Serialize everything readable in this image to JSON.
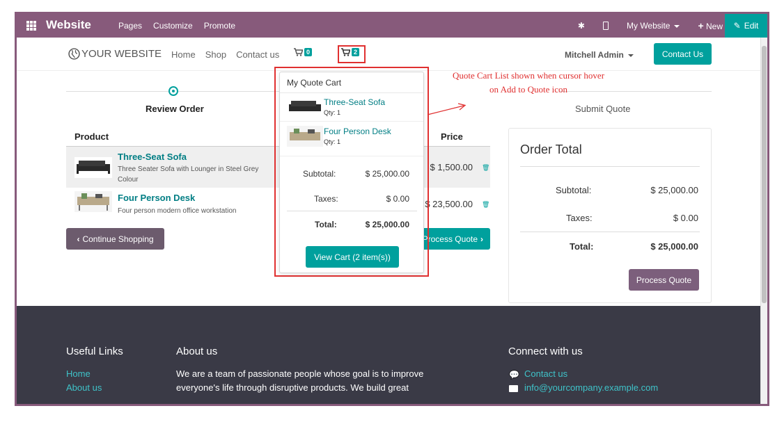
{
  "adminbar": {
    "brand": "Website",
    "menu": [
      "Pages",
      "Customize",
      "Promote"
    ],
    "my_website": "My Website",
    "new_label": "New",
    "edit_label": "Edit"
  },
  "header": {
    "logo": "YOUR WEBSITE",
    "nav": [
      "Home",
      "Shop",
      "Contact us"
    ],
    "cart_count": "0",
    "quote_cart_count": "2",
    "user": "Mitchell Admin",
    "contact_btn": "Contact Us"
  },
  "steps": {
    "review": "Review Order",
    "submit": "Submit Quote"
  },
  "table": {
    "headers": {
      "product": "Product",
      "price": "Price"
    },
    "rows": [
      {
        "name": "Three-Seat Sofa",
        "desc": "Three Seater Sofa with Lounger in Steel Grey Colour",
        "price": "$ 1,500.00"
      },
      {
        "name": "Four Person Desk",
        "desc": "Four person modern office workstation",
        "price": "$ 23,500.00"
      }
    ]
  },
  "buttons": {
    "continue": "Continue Shopping",
    "process_left": "Process Quote"
  },
  "order_total": {
    "title": "Order Total",
    "subtotal_label": "Subtotal:",
    "subtotal": "$ 25,000.00",
    "taxes_label": "Taxes:",
    "taxes": "$ 0.00",
    "total_label": "Total:",
    "total": "$ 25,000.00",
    "process": "Process Quote"
  },
  "popover": {
    "title": "My Quote Cart",
    "items": [
      {
        "name": "Three-Seat Sofa",
        "qty": "Qty: 1"
      },
      {
        "name": "Four Person Desk",
        "qty": "Qty: 1"
      }
    ],
    "subtotal_label": "Subtotal:",
    "subtotal": "$ 25,000.00",
    "taxes_label": "Taxes:",
    "taxes": "$ 0.00",
    "total_label": "Total:",
    "total": "$ 25,000.00",
    "view_cart": "View Cart (2 item(s))"
  },
  "annotation": "Quote Cart List shown when cursor hover on Add to Quote icon",
  "footer": {
    "useful_links": "Useful Links",
    "links": [
      "Home",
      "About us"
    ],
    "about_title": "About us",
    "about_text": "We are a team of passionate people whose goal is to improve everyone's life through disruptive products. We build great",
    "connect_title": "Connect with us",
    "contact_link": "Contact us",
    "email": "info@yourcompany.example.com"
  },
  "colors": {
    "brand": "#875a7b",
    "accent": "#00a09d",
    "footer_bg": "#3a3a46",
    "annotation": "#e03030"
  }
}
